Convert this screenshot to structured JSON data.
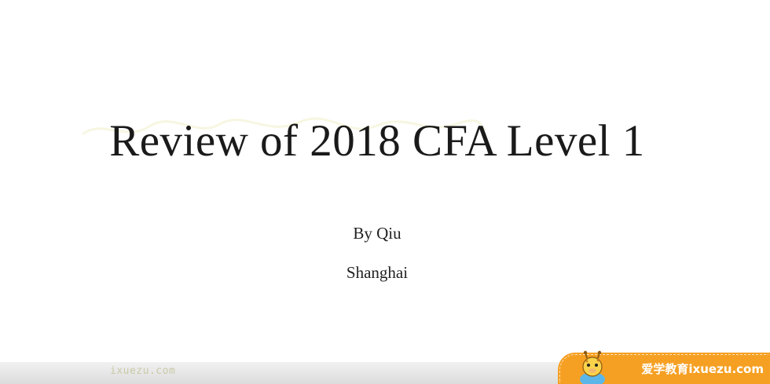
{
  "slide": {
    "title": "Review of 2018 CFA Level 1",
    "byline": "By Qiu",
    "location": "Shanghai"
  },
  "watermark": {
    "site_text": "ixuezu.com",
    "brand_text": "爱学教育ixuezu.com",
    "brand_color": "#f6a023"
  },
  "icons": {
    "mascot": "giraffe-mascot-icon"
  }
}
